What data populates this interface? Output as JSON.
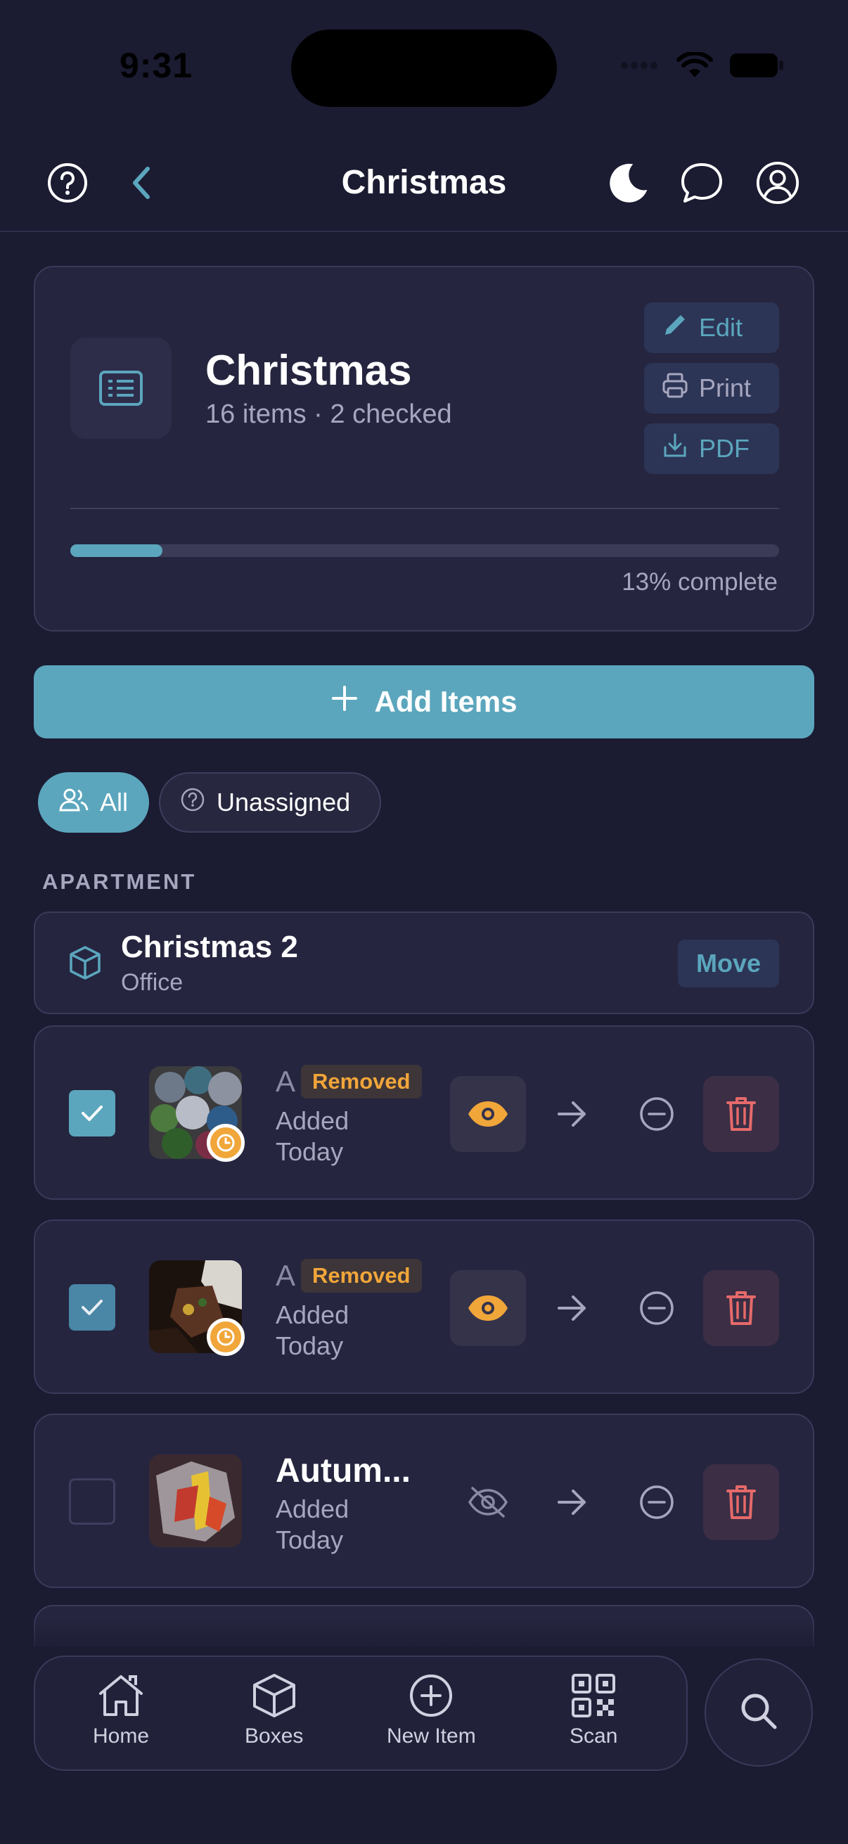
{
  "status_bar": {
    "time": "9:31"
  },
  "header": {
    "title": "Christmas"
  },
  "list_card": {
    "name": "Christmas",
    "subtitle": "16 items · 2 checked",
    "edit_label": "Edit",
    "print_label": "Print",
    "pdf_label": "PDF",
    "progress_percent": 13,
    "progress_text": "13% complete"
  },
  "add_items_label": "Add Items",
  "filters": {
    "all_label": "All",
    "unassigned_label": "Unassigned"
  },
  "section_label": "APARTMENT",
  "box": {
    "name": "Christmas 2",
    "location": "Office",
    "move_label": "Move"
  },
  "items": [
    {
      "name_truncated": "A",
      "badge": "Removed",
      "added_line1": "Added",
      "added_line2": "Today",
      "checked": true
    },
    {
      "name_truncated": "A",
      "badge": "Removed",
      "added_line1": "Added",
      "added_line2": "Today",
      "checked": true
    },
    {
      "name": "Autum...",
      "added_line1": "Added",
      "added_line2": "Today",
      "checked": false
    }
  ],
  "nav": {
    "home": "Home",
    "boxes": "Boxes",
    "new_item": "New Item",
    "scan": "Scan"
  },
  "colors": {
    "background": "#1b1b32",
    "card": "#25253f",
    "accent": "#5ba6bd",
    "warning": "#f1a63a",
    "danger": "#e56a6a"
  }
}
